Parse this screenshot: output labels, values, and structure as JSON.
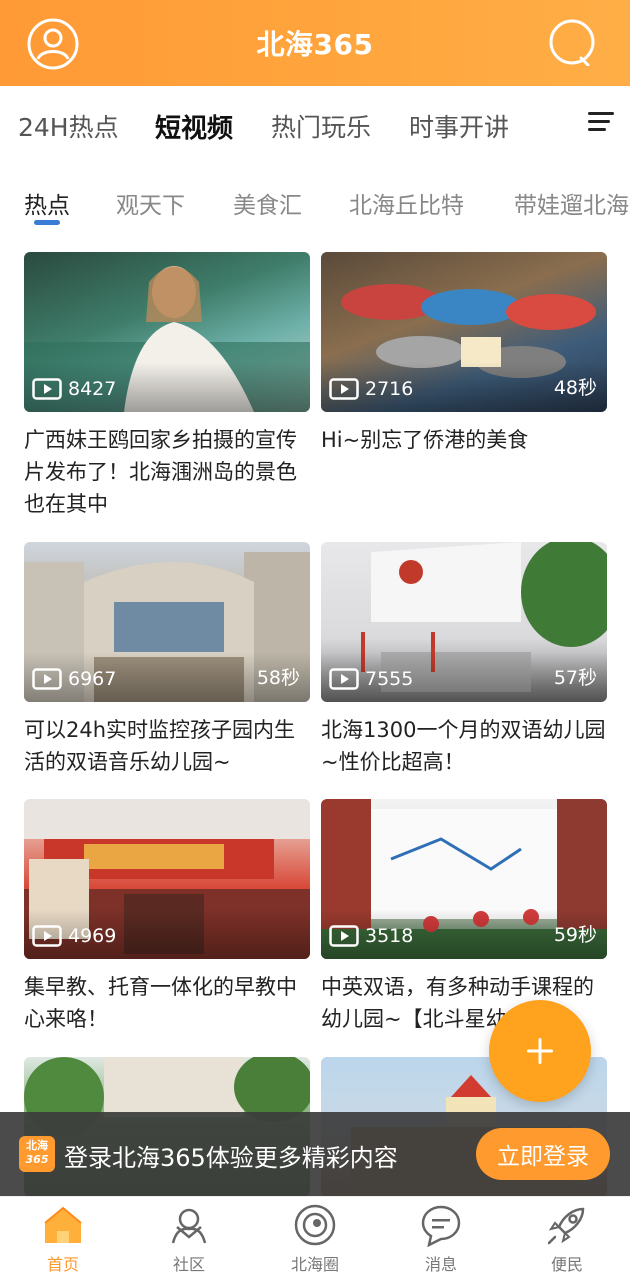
{
  "header": {
    "title": "北海365",
    "avatar_icon": "user-icon",
    "search_icon": "search-icon"
  },
  "main_tabs": [
    {
      "label": "24H热点",
      "active": false
    },
    {
      "label": "短视频",
      "active": true
    },
    {
      "label": "热门玩乐",
      "active": false
    },
    {
      "label": "时事开讲",
      "active": false
    }
  ],
  "sub_tabs": [
    {
      "label": "热点",
      "active": true
    },
    {
      "label": "观天下",
      "active": false
    },
    {
      "label": "美食汇",
      "active": false
    },
    {
      "label": "北海丘比特",
      "active": false
    },
    {
      "label": "带娃遛北海",
      "active": false
    }
  ],
  "videos": [
    {
      "views": "8427",
      "duration": "",
      "title": "广西妹王鸥回家乡拍摄的宣传片发布了！北海涠洲岛的景色也在其中"
    },
    {
      "views": "2716",
      "duration": "48秒",
      "title": "Hi~别忘了侨港的美食"
    },
    {
      "views": "6967",
      "duration": "58秒",
      "title": "可以24h实时监控孩子园内生活的双语音乐幼儿园~"
    },
    {
      "views": "7555",
      "duration": "57秒",
      "title": "北海1300一个月的双语幼儿园~性价比超高！"
    },
    {
      "views": "4969",
      "duration": "",
      "title": "集早教、托育一体化的早教中心来咯！"
    },
    {
      "views": "3518",
      "duration": "59秒",
      "title": "中英双语，有多种动手课程的幼儿园~【北斗星幼儿"
    },
    {
      "views": "",
      "duration": "",
      "title": ""
    },
    {
      "views": "",
      "duration": "",
      "title": ""
    }
  ],
  "login_banner": {
    "logo_top": "北海",
    "logo_bottom": "365",
    "text": "登录北海365体验更多精彩内容",
    "button": "立即登录"
  },
  "fab_icon": "plus-icon",
  "bottom_nav": [
    {
      "label": "首页",
      "icon": "home-icon",
      "active": true
    },
    {
      "label": "社区",
      "icon": "community-icon",
      "active": false
    },
    {
      "label": "北海圈",
      "icon": "circle-icon",
      "active": false
    },
    {
      "label": "消息",
      "icon": "message-icon",
      "active": false
    },
    {
      "label": "便民",
      "icon": "rocket-icon",
      "active": false
    }
  ],
  "colors": {
    "accent": "#ff9a2e",
    "header_start": "#ff9a36",
    "header_end": "#ffae47",
    "sub_tab_indicator": "#3a7bd5"
  }
}
